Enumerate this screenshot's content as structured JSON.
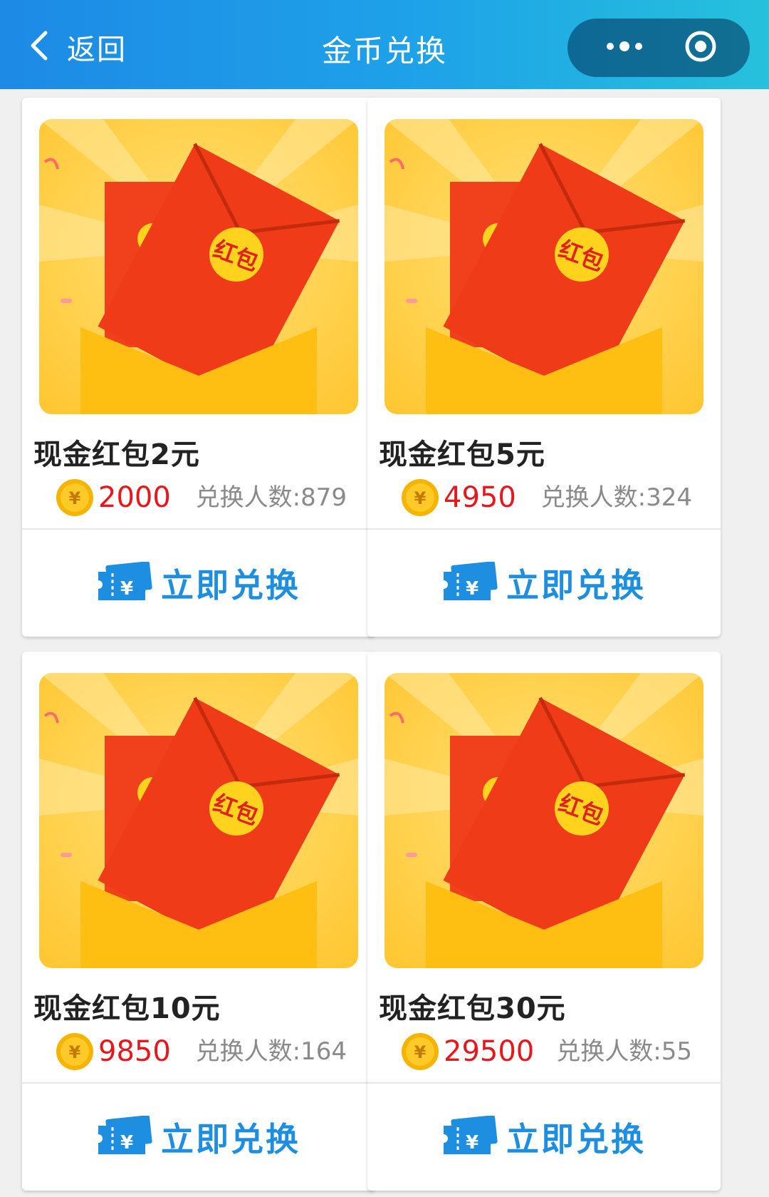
{
  "header": {
    "back_label": "返回",
    "title": "金币兑换",
    "icons": [
      "chevron-left-icon",
      "more-dots-icon",
      "close-circle-icon"
    ]
  },
  "colors": {
    "nav_gradient_start": "#1d8ae6",
    "nav_gradient_end": "#26c1dc",
    "price_red": "#e8171b",
    "accent_blue": "#1e8ee0"
  },
  "products": [
    {
      "title": "现金红包2元",
      "price": "2000",
      "exchanged": "兑换人数:879",
      "button": "立即兑换",
      "image_text": "红包"
    },
    {
      "title": "现金红包5元",
      "price": "4950",
      "exchanged": "兑换人数:324",
      "button": "立即兑换",
      "image_text": "红包"
    },
    {
      "title": "现金红包10元",
      "price": "9850",
      "exchanged": "兑换人数:164",
      "button": "立即兑换",
      "image_text": "红包"
    },
    {
      "title": "现金红包30元",
      "price": "29500",
      "exchanged": "兑换人数:55",
      "button": "立即兑换",
      "image_text": "红包"
    }
  ],
  "coin_symbol": "¥"
}
